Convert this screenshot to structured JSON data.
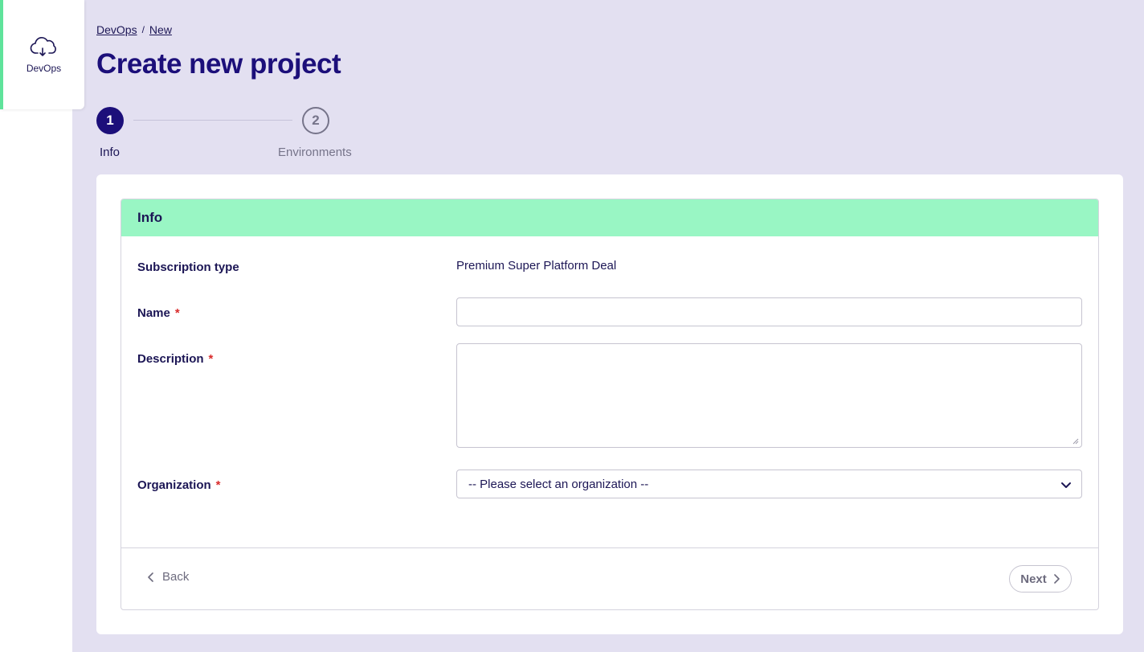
{
  "sidebar": {
    "items": [
      {
        "label": "DevOps",
        "icon": "cloud-icon",
        "active": true
      }
    ]
  },
  "breadcrumb": {
    "items": [
      "DevOps",
      "New"
    ],
    "separator": "/"
  },
  "page": {
    "title": "Create new project"
  },
  "stepper": {
    "steps": [
      {
        "number": "1",
        "label": "Info",
        "active": true
      },
      {
        "number": "2",
        "label": "Environments",
        "active": false
      }
    ]
  },
  "form": {
    "section_title": "Info",
    "subscription_type": {
      "label": "Subscription type",
      "value": "Premium Super Platform Deal"
    },
    "name": {
      "label": "Name",
      "required_mark": "*",
      "value": ""
    },
    "description": {
      "label": "Description",
      "required_mark": "*",
      "value": ""
    },
    "organization": {
      "label": "Organization",
      "required_mark": "*",
      "selected": "-- Please select an organization --"
    }
  },
  "footer": {
    "back_label": "Back",
    "next_label": "Next"
  },
  "colors": {
    "background": "#e3e0f1",
    "primary": "#1c0f7a",
    "accent_green": "#99f6c4",
    "active_border": "#5fe39b",
    "required": "#d92b2b"
  }
}
